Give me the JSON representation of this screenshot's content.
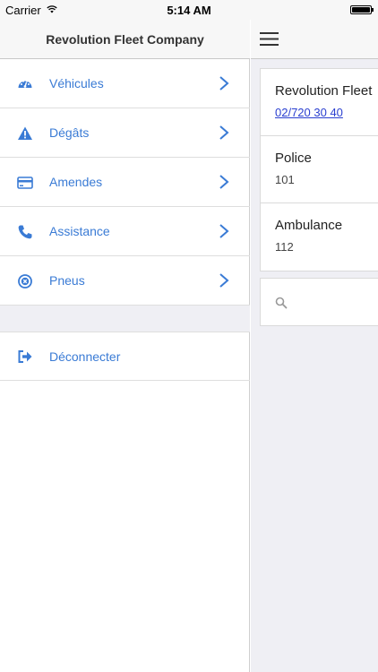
{
  "status_bar": {
    "carrier": "Carrier",
    "time": "5:14 AM",
    "battery_level": 1.0,
    "icons": [
      "wifi-icon",
      "battery-icon"
    ]
  },
  "drawer": {
    "title": "Revolution Fleet Company",
    "accent_color": "#3a7bd5",
    "items": [
      {
        "label": "Véhicules",
        "icon": "dashboard-gauge-icon"
      },
      {
        "label": "Dégâts",
        "icon": "warning-triangle-icon"
      },
      {
        "label": "Amendes",
        "icon": "credit-card-icon"
      },
      {
        "label": "Assistance",
        "icon": "phone-icon"
      },
      {
        "label": "Pneus",
        "icon": "circle-x-icon"
      }
    ],
    "logout": {
      "label": "Déconnecter",
      "icon": "sign-out-icon"
    }
  },
  "content": {
    "menu_icon": "hamburger-menu-icon",
    "contacts": [
      {
        "name": "Revolution Fleet",
        "phone": "02/720 30 40"
      },
      {
        "name": "Police",
        "phone": "101"
      },
      {
        "name": "Ambulance",
        "phone": "112"
      }
    ],
    "search": {
      "placeholder": "",
      "icon": "search-icon"
    }
  }
}
